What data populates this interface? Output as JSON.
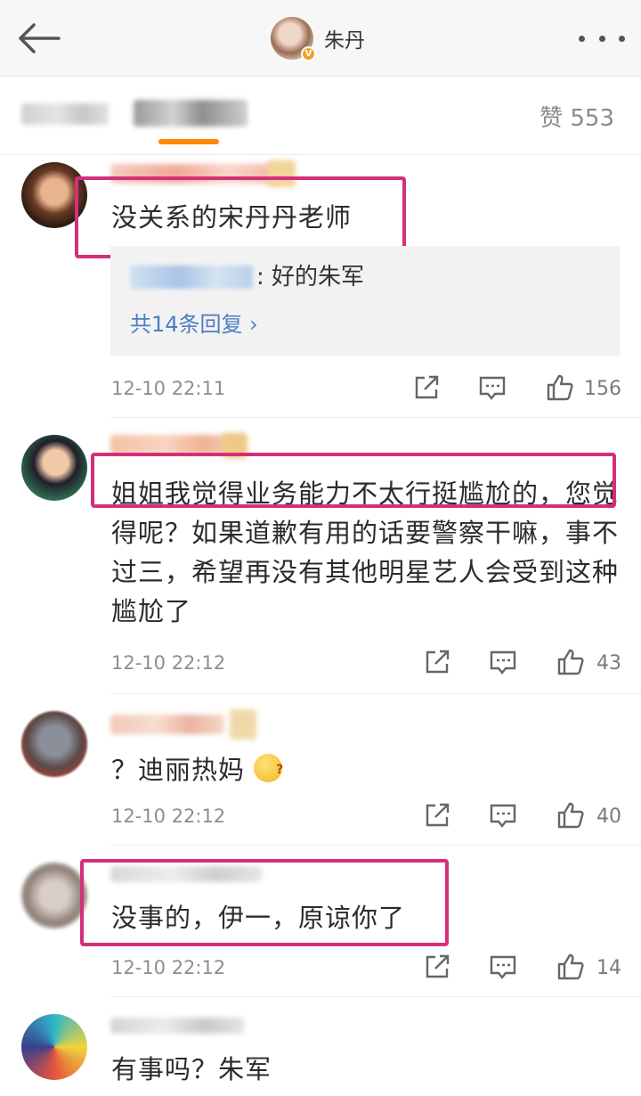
{
  "header": {
    "back_icon": "back-arrow-icon",
    "profile_name": "朱丹",
    "verified_badge": "V",
    "more_icon": "more-dots-icon"
  },
  "tabs": {
    "likes_total": "赞 553"
  },
  "comments": [
    {
      "text": "没关系的宋丹丹老师",
      "reply_preview": {
        "text": ": 好的朱军",
        "more": "共14条回复 ›"
      },
      "time": "12-10 22:11",
      "likes": "156"
    },
    {
      "text": "姐姐我觉得业务能力不太行挺尴尬的，您觉得呢？如果道歉有用的话要警察干嘛，事不过三，希望再没有其他明星艺人会受到这种尴尬了",
      "time": "12-10 22:12",
      "likes": "43"
    },
    {
      "text": "？迪丽热妈",
      "time": "12-10 22:12",
      "likes": "40"
    },
    {
      "text": "没事的，伊一，原谅你了",
      "time": "12-10 22:12",
      "likes": "14"
    },
    {
      "text": "有事吗？朱军"
    }
  ],
  "colors": {
    "highlight_border": "#d4307a",
    "tab_underline": "#ff8a00",
    "link_blue": "#4d7dc4"
  }
}
